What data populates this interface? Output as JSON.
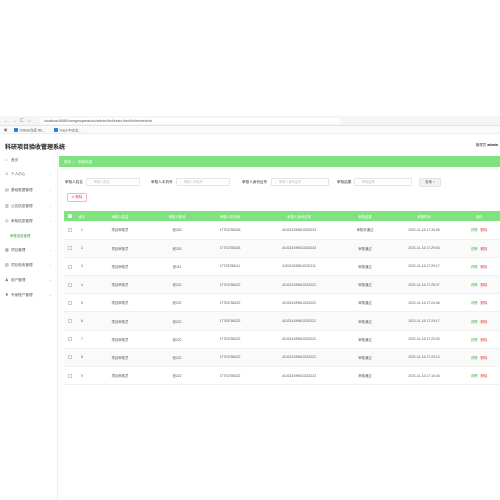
{
  "browser": {
    "back": "←",
    "forward": "→",
    "reload": "C",
    "home": "⌂",
    "url": "localhost:8080/xiangmuyanshou/admin/dist/index.html#/shenhexinxi"
  },
  "bookmarks": [
    {
      "label": "GitHub仓库 RE..."
    },
    {
      "label": "Vue3 中文文..."
    }
  ],
  "header": {
    "title": "科研项目验收管理系统",
    "user_role": "管理员",
    "user_name": "admin"
  },
  "sidebar": {
    "items": [
      {
        "label": "首页",
        "icon": "home-icon",
        "glyph": "⌂",
        "has_arrow": false
      },
      {
        "label": "个人中心",
        "icon": "user-icon",
        "glyph": "♙",
        "has_arrow": true
      },
      {
        "label": "基础数据管理",
        "icon": "database-icon",
        "glyph": "▤",
        "has_arrow": true
      },
      {
        "label": "公告信息管理",
        "icon": "notice-icon",
        "glyph": "▥",
        "has_arrow": true
      },
      {
        "label": "审核信息管理",
        "icon": "audit-icon",
        "glyph": "◎",
        "has_arrow": true
      },
      {
        "label": "项目管理",
        "icon": "project-icon",
        "glyph": "▦",
        "has_arrow": true
      },
      {
        "label": "项目验收管理",
        "icon": "acceptance-icon",
        "glyph": "▧",
        "has_arrow": true
      },
      {
        "label": "用户管理",
        "icon": "users-icon",
        "glyph": "♟",
        "has_arrow": true
      },
      {
        "label": "专家账户管理",
        "icon": "expert-icon",
        "glyph": "♜",
        "has_arrow": true
      }
    ],
    "active_sub": "审核信息管理",
    "arrow": "⌄"
  },
  "breadcrumb": {
    "home": "首页",
    "separator": "/",
    "current": "审核信息"
  },
  "filters": {
    "applicant_name": {
      "label": "审核人姓名",
      "placeholder": "审核人姓名"
    },
    "applicant_phone": {
      "label": "审核人手机号",
      "placeholder": "审核人手机号"
    },
    "applicant_id": {
      "label": "审核人身份证号",
      "placeholder": "审核人身份证号"
    },
    "audit_result": {
      "label": "审核结果",
      "placeholder": "审核结果"
    },
    "search_button": "查询",
    "search_glyph": "⌕"
  },
  "delete_button": "删除",
  "table": {
    "columns": [
      "",
      "索引",
      "审核人姓名",
      "审核人账号",
      "审核人手机号",
      "审核人身份证号",
      "审核结果",
      "审核时间",
      "操作"
    ],
    "action_detail": "详情",
    "action_delete": "删除",
    "rows": [
      {
        "index": "1",
        "name": "项目审核员",
        "account": "张333",
        "phone": "17703786333",
        "id_card": "410224199610232033",
        "result": "审核未通过",
        "time": "2021-11-16 17:30:26"
      },
      {
        "index": "2",
        "name": "项目审核员",
        "account": "张333",
        "phone": "17703786333",
        "id_card": "410224199610232033",
        "result": "审核通过",
        "time": "2021-11-16 17:29:53"
      },
      {
        "index": "3",
        "name": "项目审核员",
        "account": "张111",
        "phone": "17703786111",
        "id_card": "410224199610232111",
        "result": "审核通过",
        "time": "2021-11-16 17:29:17"
      },
      {
        "index": "4",
        "name": "项目审核员",
        "account": "张222",
        "phone": "17703786222",
        "id_card": "410224199610232222",
        "result": "审核通过",
        "time": "2021-11-16 17:25:37"
      },
      {
        "index": "5",
        "name": "项目审核员",
        "account": "张222",
        "phone": "17703786222",
        "id_card": "410224199610232222",
        "result": "审核通过",
        "time": "2021-11-16 17:24:46"
      },
      {
        "index": "6",
        "name": "项目审核员",
        "account": "张222",
        "phone": "17703786222",
        "id_card": "410224199610232222",
        "result": "审核通过",
        "time": "2021-11-16 17:24:17"
      },
      {
        "index": "7",
        "name": "项目审核员",
        "account": "张222",
        "phone": "17703786222",
        "id_card": "410224199610232222",
        "result": "审核通过",
        "time": "2021-11-16 17:23:33"
      },
      {
        "index": "8",
        "name": "项目审核员",
        "account": "张222",
        "phone": "17703786222",
        "id_card": "410224199610232222",
        "result": "审核通过",
        "time": "2021-11-16 17:20:12"
      },
      {
        "index": "9",
        "name": "项目审核员",
        "account": "张222",
        "phone": "17703786222",
        "id_card": "410224199610232222",
        "result": "审核通过",
        "time": "2021-11-16 17:16:44"
      }
    ]
  },
  "colors": {
    "accent": "#7fe27f",
    "danger": "#e03c3c",
    "success": "#3aa83a"
  }
}
